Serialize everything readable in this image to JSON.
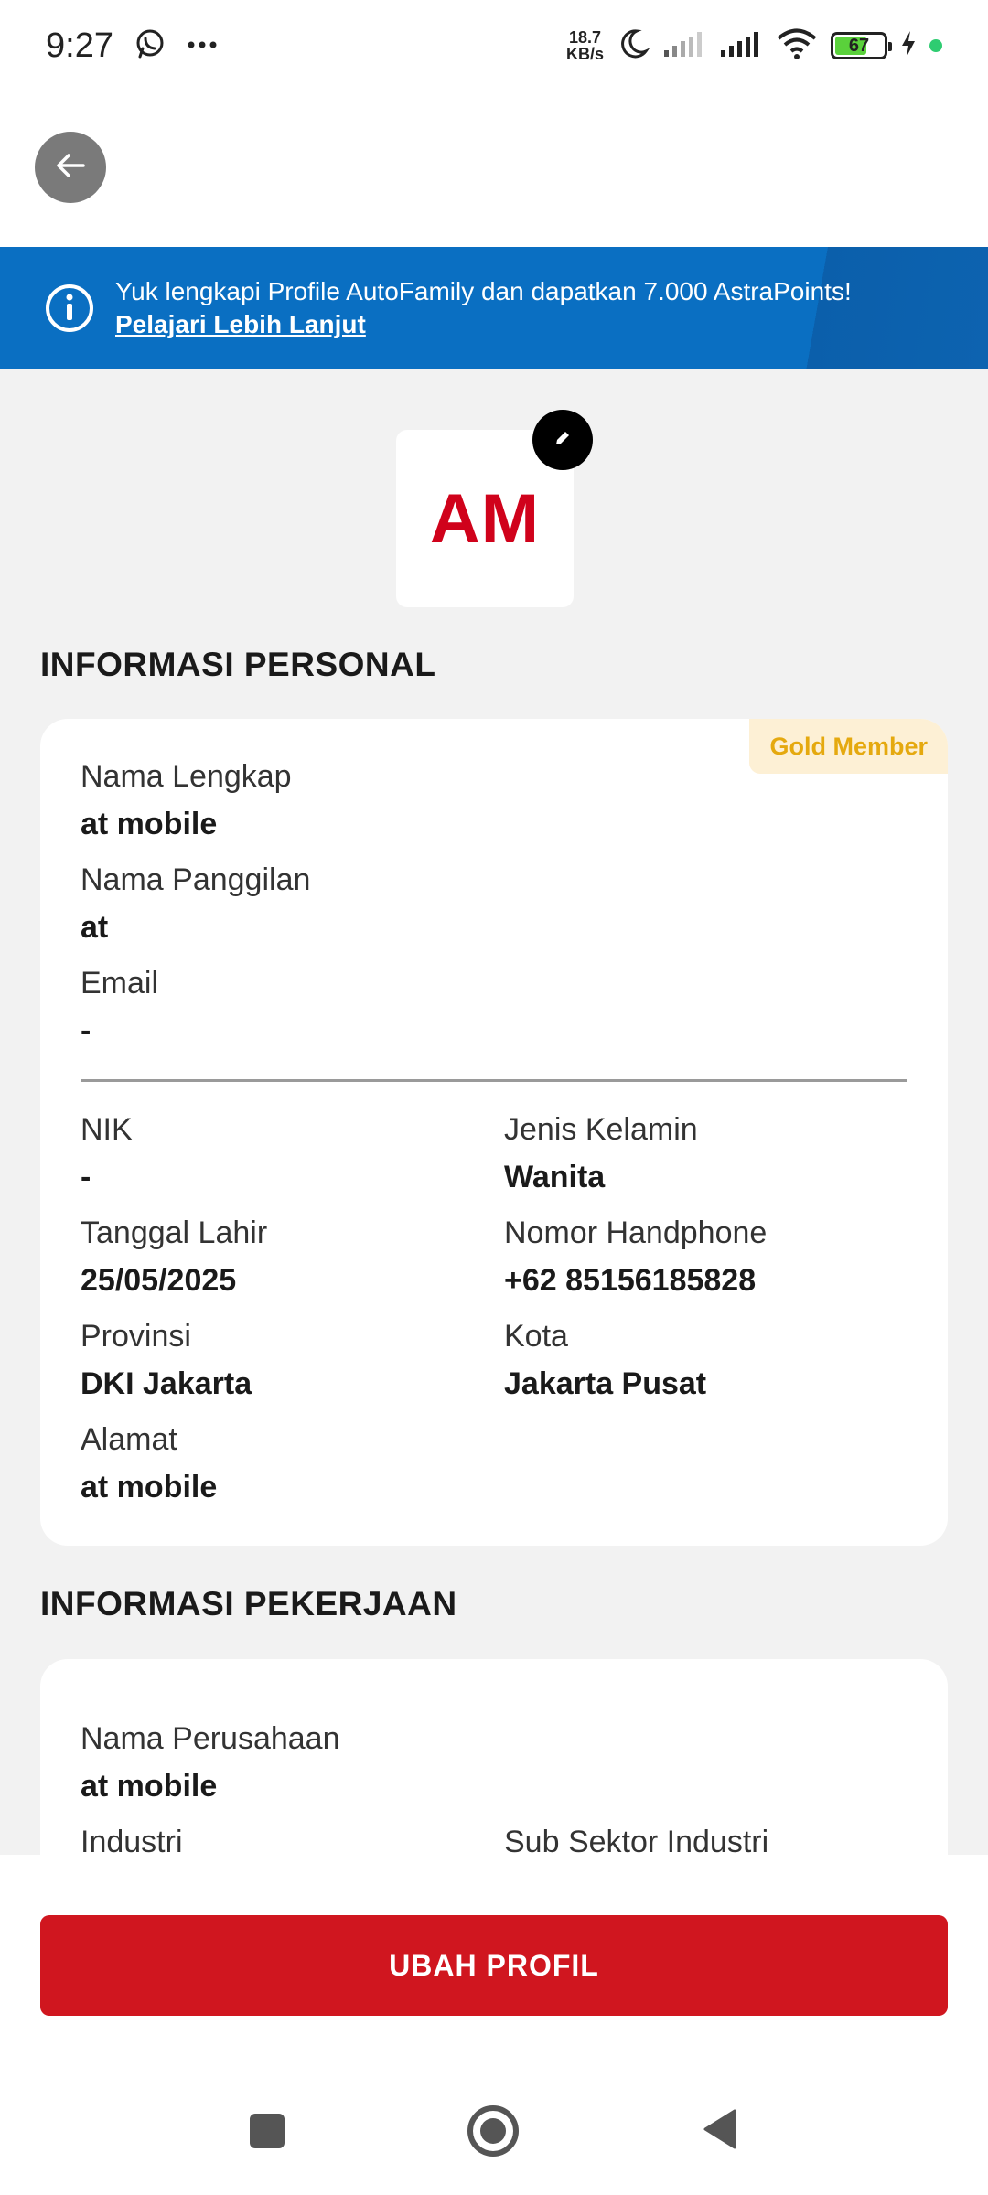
{
  "status_bar": {
    "time": "9:27",
    "speed_value": "18.7",
    "speed_unit": "KB/s",
    "battery": "67",
    "battery_level": 0.67
  },
  "banner": {
    "message": "Yuk lengkapi Profile AutoFamily dan dapatkan 7.000 AstraPoints!",
    "link": "Pelajari Lebih Lanjut"
  },
  "avatar": {
    "initials": "AM"
  },
  "personal": {
    "title": "INFORMASI PERSONAL",
    "badge": "Gold Member",
    "fields": {
      "full_name": {
        "label": "Nama Lengkap",
        "value": "at mobile"
      },
      "nickname": {
        "label": "Nama Panggilan",
        "value": "at"
      },
      "email": {
        "label": "Email",
        "value": "-"
      },
      "nik": {
        "label": "NIK",
        "value": "-"
      },
      "gender": {
        "label": "Jenis Kelamin",
        "value": "Wanita"
      },
      "birth_date": {
        "label": "Tanggal Lahir",
        "value": "25/05/2025"
      },
      "phone": {
        "label": "Nomor Handphone",
        "value": "+62 85156185828"
      },
      "province": {
        "label": "Provinsi",
        "value": "DKI Jakarta"
      },
      "city": {
        "label": "Kota",
        "value": "Jakarta Pusat"
      },
      "address": {
        "label": "Alamat",
        "value": "at mobile"
      }
    }
  },
  "work": {
    "title": "INFORMASI PEKERJAAN",
    "fields": {
      "company": {
        "label": "Nama Perusahaan",
        "value": "at mobile"
      },
      "industry": {
        "label": "Industri"
      },
      "sub_sector": {
        "label": "Sub Sektor Industri"
      }
    }
  },
  "cta": {
    "label": "UBAH PROFIL"
  },
  "colors": {
    "brand_red": "#d0161f",
    "banner_blue": "#0a6fc2",
    "gold": "#e5a90f"
  }
}
